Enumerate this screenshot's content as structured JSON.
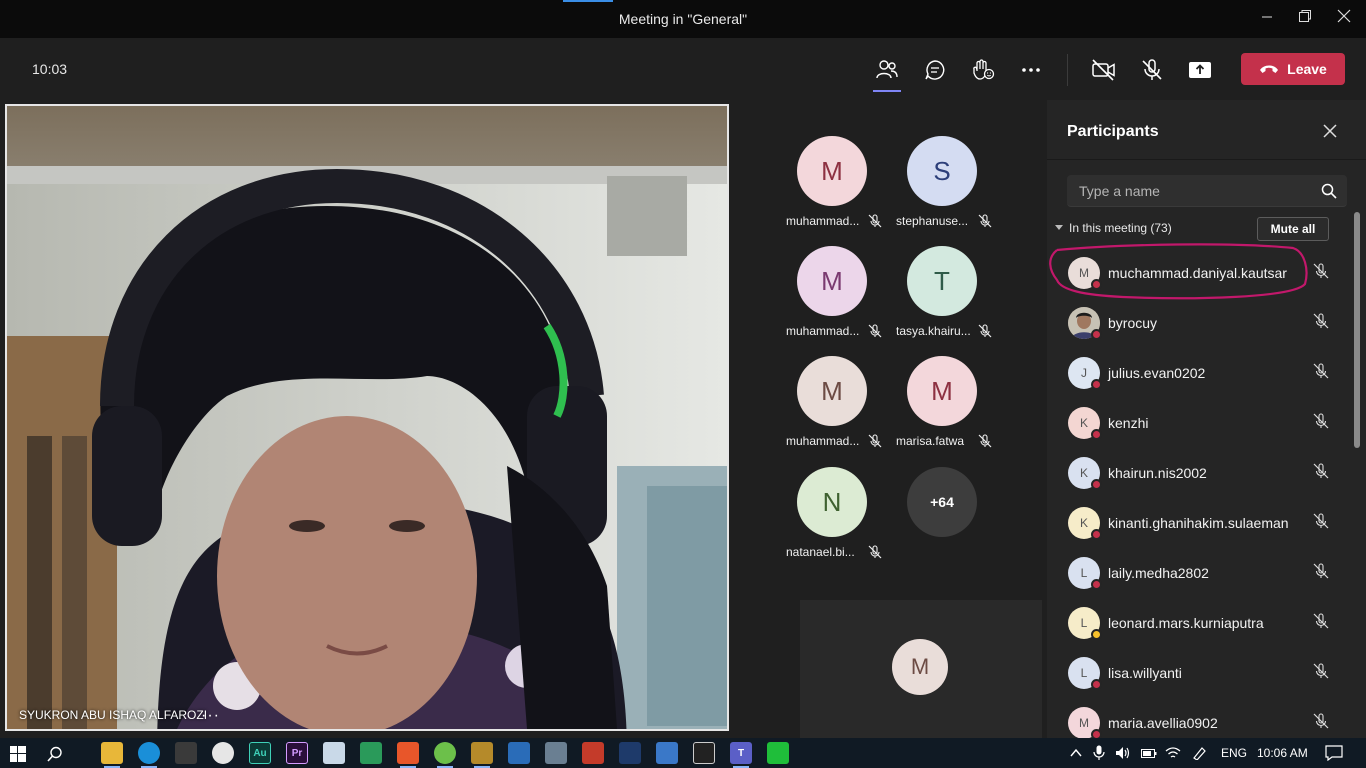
{
  "window": {
    "title": "Meeting in \"General\""
  },
  "toolbar": {
    "clock": "10:03",
    "leave_label": "Leave"
  },
  "main_video": {
    "name": "SYUKRON ABU ISHAQ ALFAROZI",
    "more": "···"
  },
  "grid": [
    {
      "initial": "M",
      "name": "muhammad...",
      "bg": "#f3d7db",
      "fg": "#8d3041"
    },
    {
      "initial": "S",
      "name": "stephanuse...",
      "bg": "#d4dcf2",
      "fg": "#2d3f7a"
    },
    {
      "initial": "M",
      "name": "muhammad...",
      "bg": "#ecd6ea",
      "fg": "#7a3a70"
    },
    {
      "initial": "T",
      "name": "tasya.khairu...",
      "bg": "#d3e9df",
      "fg": "#2f5b49"
    },
    {
      "initial": "M",
      "name": "muhammad...",
      "bg": "#e9ddd9",
      "fg": "#6c4b44"
    },
    {
      "initial": "M",
      "name": "marisa.fatwa",
      "bg": "#f3d7db",
      "fg": "#8d3041"
    },
    {
      "initial": "N",
      "name": "natanael.bi...",
      "bg": "#dcebd3",
      "fg": "#3f6130"
    }
  ],
  "grid_more": "+64",
  "self_tile": {
    "initial": "M"
  },
  "panel": {
    "title": "Participants",
    "search_placeholder": "Type a name",
    "section_label": "In this meeting (73)",
    "mute_all": "Mute all",
    "participants": [
      {
        "initial": "M",
        "name": "muchammad.daniyal.kautsar",
        "bg": "#e9ddd9",
        "status": "busy"
      },
      {
        "initial": "",
        "name": "byrocuy",
        "bg": "#8a7a68",
        "status": "busy",
        "photo": true
      },
      {
        "initial": "J",
        "name": "julius.evan0202",
        "bg": "#dde6f2",
        "status": "busy"
      },
      {
        "initial": "K",
        "name": "kenzhi",
        "bg": "#f3d6d2",
        "status": "busy"
      },
      {
        "initial": "K",
        "name": "khairun.nis2002",
        "bg": "#d9e1f0",
        "status": "busy"
      },
      {
        "initial": "K",
        "name": "kinanti.ghanihakim.sulaeman",
        "bg": "#f6ecc9",
        "status": "busy"
      },
      {
        "initial": "L",
        "name": "laily.medha2802",
        "bg": "#d9e1f0",
        "status": "busy"
      },
      {
        "initial": "L",
        "name": "leonard.mars.kurniaputra",
        "bg": "#f6ecc9",
        "status": "away"
      },
      {
        "initial": "L",
        "name": "lisa.willyanti",
        "bg": "#d9e1f0",
        "status": "busy"
      },
      {
        "initial": "M",
        "name": "maria.avellia0902",
        "bg": "#f3d7db",
        "status": "busy"
      }
    ]
  },
  "taskbar": {
    "lang": "ENG",
    "time": "10:06 AM"
  },
  "colors": {
    "accent": "#7f85f5",
    "leave": "#c4314b",
    "highlight": "#c2186b"
  }
}
